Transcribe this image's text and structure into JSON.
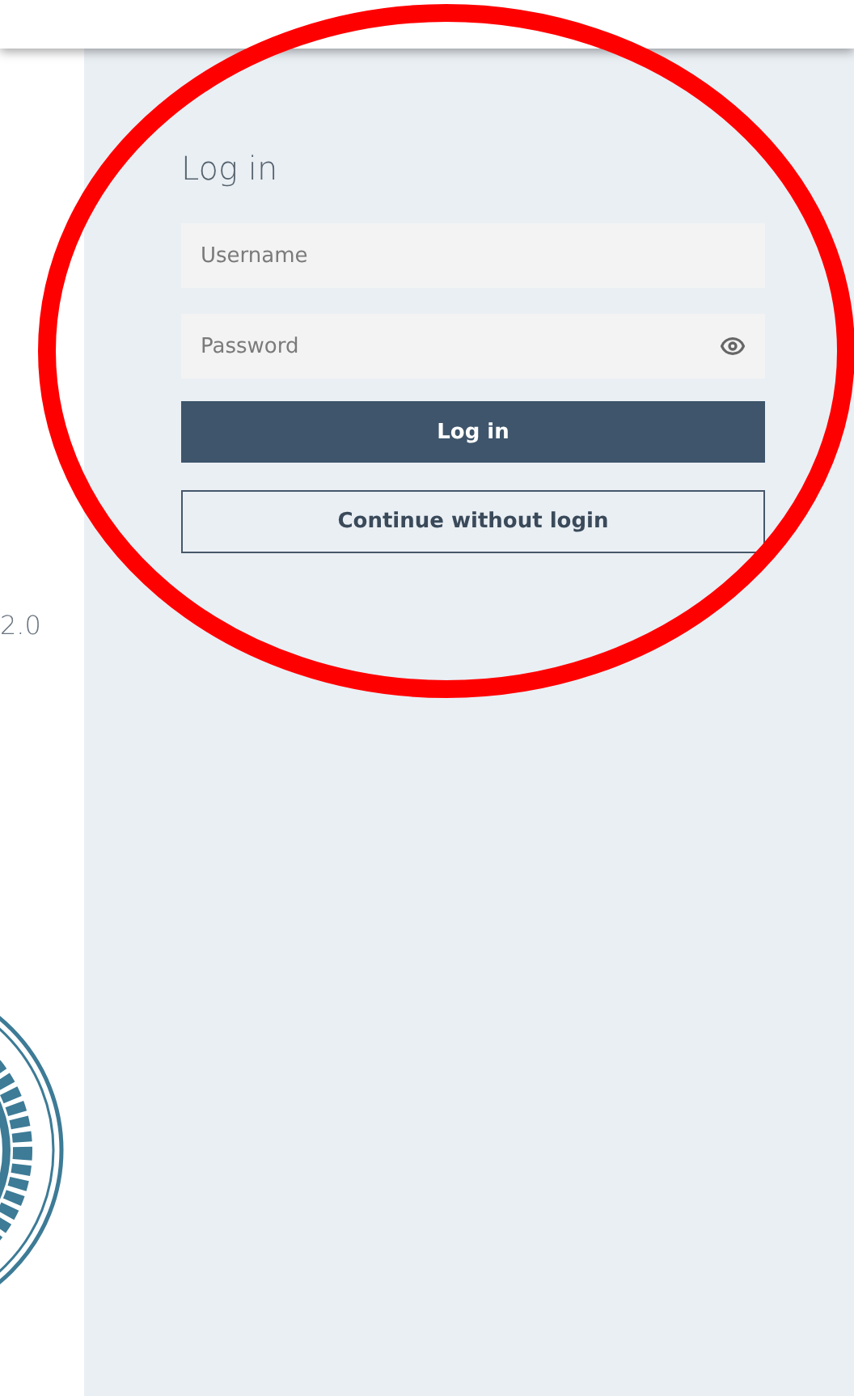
{
  "sidebar": {
    "version": "2.0"
  },
  "login": {
    "title": "Log in",
    "username": {
      "placeholder": "Username"
    },
    "password": {
      "placeholder": "Password"
    },
    "submit_button": "Log in",
    "continue_button": "Continue without login"
  }
}
